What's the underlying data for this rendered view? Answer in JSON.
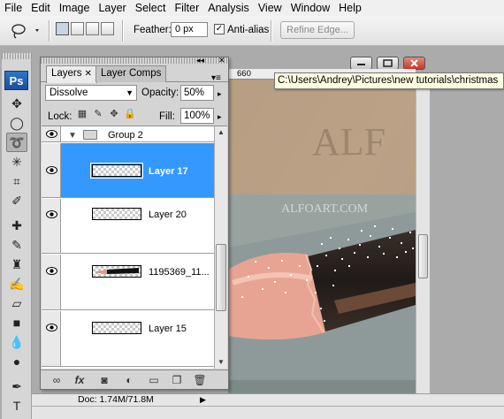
{
  "menu": [
    "File",
    "Edit",
    "Image",
    "Layer",
    "Select",
    "Filter",
    "Analysis",
    "View",
    "Window",
    "Help"
  ],
  "options": {
    "feather_label": "Feather:",
    "feather_value": "0 px",
    "antialias_label": "Anti-alias",
    "antialias_checked": "✓",
    "refine_edge_label": "Refine Edge..."
  },
  "tools": {
    "logo": "Ps",
    "icons": [
      "move-tool",
      "marquee-tool",
      "lasso-tool",
      "magic-wand-tool",
      "crop-tool",
      "eyedropper-tool",
      "healing-brush-tool",
      "brush-tool",
      "clone-stamp-tool",
      "history-brush-tool",
      "eraser-tool",
      "gradient-tool",
      "blur-tool",
      "dodge-tool",
      "pen-tool",
      "type-tool"
    ]
  },
  "document": {
    "path_tooltip": "C:\\Users\\Andrey\\Pictures\\new tutorials\\christmas",
    "ruler_number": "660",
    "watermark_big": "ALF",
    "watermark_small": "ALFOART.COM",
    "doc_info": "Doc: 1.74M/71.8M",
    "status_arrow": "▶"
  },
  "layers_panel": {
    "tabs": [
      {
        "label": "Layers",
        "close": "✕"
      },
      {
        "label": "Layer Comps"
      }
    ],
    "collapse_icon": "◂◂",
    "close_icon": "✕",
    "panel_menu": "▾≡",
    "blend_mode": "Dissolve",
    "opacity_label": "Opacity:",
    "opacity_value": "50%",
    "lock_label": "Lock:",
    "fill_label": "Fill:",
    "fill_value": "100%",
    "group_name": "Group 2",
    "layers": [
      {
        "name": "Layer 17",
        "selected": true
      },
      {
        "name": "Layer 20",
        "selected": false
      },
      {
        "name": "1195369_11...",
        "selected": false
      },
      {
        "name": "Layer 15",
        "selected": false
      }
    ],
    "footer_icons": [
      "link-layers-icon",
      "fx-icon",
      "add-mask-icon",
      "adjustment-layer-icon",
      "new-group-icon",
      "new-layer-icon",
      "delete-layer-icon"
    ],
    "fx_label": "fx"
  },
  "colors": {
    "selection_blue": "#3399ff",
    "ps_blue": "#1b4f9a"
  }
}
